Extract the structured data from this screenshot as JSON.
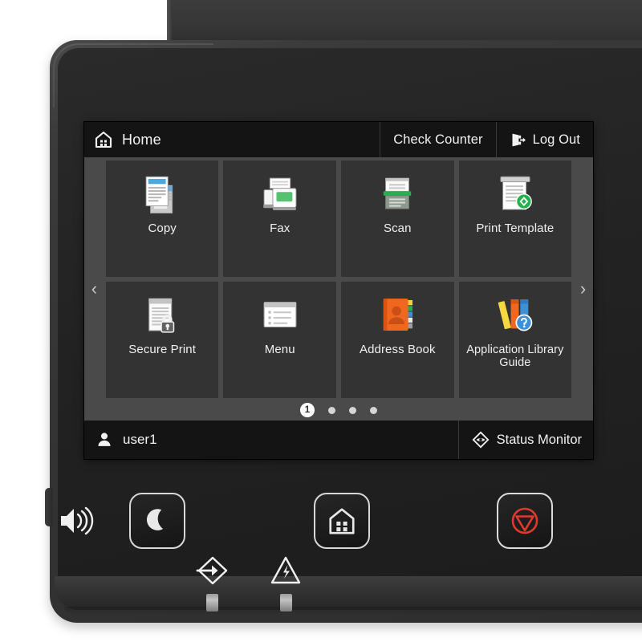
{
  "device": {
    "type": "multifunction-printer-control-panel"
  },
  "screen": {
    "top_bar": {
      "home": {
        "label": "Home",
        "icon": "home-icon"
      },
      "check_counter": {
        "label": "Check Counter"
      },
      "log_out": {
        "label": "Log Out",
        "icon": "logout-icon"
      }
    },
    "navigation": {
      "prev_arrow": "‹",
      "next_arrow": "›"
    },
    "tiles": [
      {
        "label": "Copy",
        "icon": "copy-icon",
        "accent": "#4aa8e0"
      },
      {
        "label": "Fax",
        "icon": "fax-icon",
        "accent": "#56c271"
      },
      {
        "label": "Scan",
        "icon": "scan-icon",
        "accent": "#22b14c"
      },
      {
        "label": "Print Template",
        "icon": "print-template-icon",
        "accent": "#22b14c"
      },
      {
        "label": "Secure Print",
        "icon": "secure-print-icon",
        "accent": "#6b6b6b"
      },
      {
        "label": "Menu",
        "icon": "menu-icon",
        "accent": "#b9b9b9"
      },
      {
        "label": "Address Book",
        "icon": "address-book-icon",
        "accent": "#f0671f"
      },
      {
        "label": "Application Library Guide",
        "icon": "application-library-guide-icon",
        "accent": "#3d8fd6"
      }
    ],
    "pager": {
      "pages": [
        "1",
        "",
        "",
        ""
      ],
      "active_index": 0,
      "active_label": "1"
    },
    "bottom_bar": {
      "user": {
        "label": "user1",
        "icon": "user-icon"
      },
      "status_monitor": {
        "label": "Status Monitor",
        "icon": "status-monitor-icon"
      }
    },
    "colors": {
      "screen_background": "#121212",
      "bar_background": "#141414",
      "grid_background": "#4a4a4a",
      "tile_background": "#333333",
      "text": "#f2f2f2"
    }
  },
  "hardware": {
    "buttons": [
      {
        "name": "sleep",
        "icon": "moon-icon",
        "color": "#e8e8e8"
      },
      {
        "name": "home",
        "icon": "house-icon",
        "color": "#e8e8e8"
      },
      {
        "name": "stop",
        "icon": "stop-icon",
        "color": "#e03a2f"
      }
    ],
    "indicators": [
      {
        "name": "speaker",
        "icon": "speaker-icon"
      },
      {
        "name": "data",
        "icon": "data-arrow-icon"
      },
      {
        "name": "error",
        "icon": "warning-triangle-icon"
      }
    ]
  }
}
